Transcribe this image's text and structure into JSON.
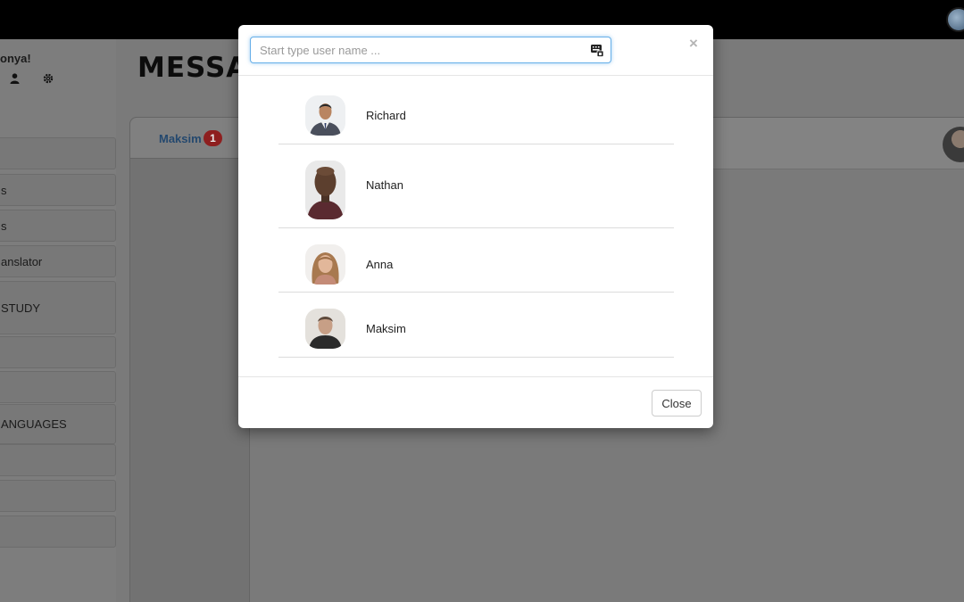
{
  "background": {
    "greeting": "onya!",
    "app_title": "MESSA",
    "sidebar_items": [
      {
        "label": ""
      },
      {
        "label": "s"
      },
      {
        "label": "s"
      },
      {
        "label": "anslator"
      },
      {
        "label": "STUDY"
      },
      {
        "label": ""
      },
      {
        "label": ""
      },
      {
        "label": "ANGUAGES"
      },
      {
        "label": ""
      },
      {
        "label": ""
      },
      {
        "label": ""
      }
    ],
    "chat_tab": {
      "name": "Maksim",
      "badge": "1"
    }
  },
  "modal": {
    "search": {
      "placeholder": "Start type user name ...",
      "value": ""
    },
    "close_x": "×",
    "users": [
      {
        "name": "Richard"
      },
      {
        "name": "Nathan"
      },
      {
        "name": "Anna"
      },
      {
        "name": "Maksim"
      }
    ],
    "close_label": "Close"
  },
  "icons": {
    "user": "user-icon",
    "gear": "gear-icon",
    "keyboard": "keyboard-icon",
    "close": "close-icon",
    "globe": "globe-icon"
  },
  "colors": {
    "tab_name": "#337ab7",
    "badge": "#d9534f",
    "input_focus": "#66afe9"
  }
}
